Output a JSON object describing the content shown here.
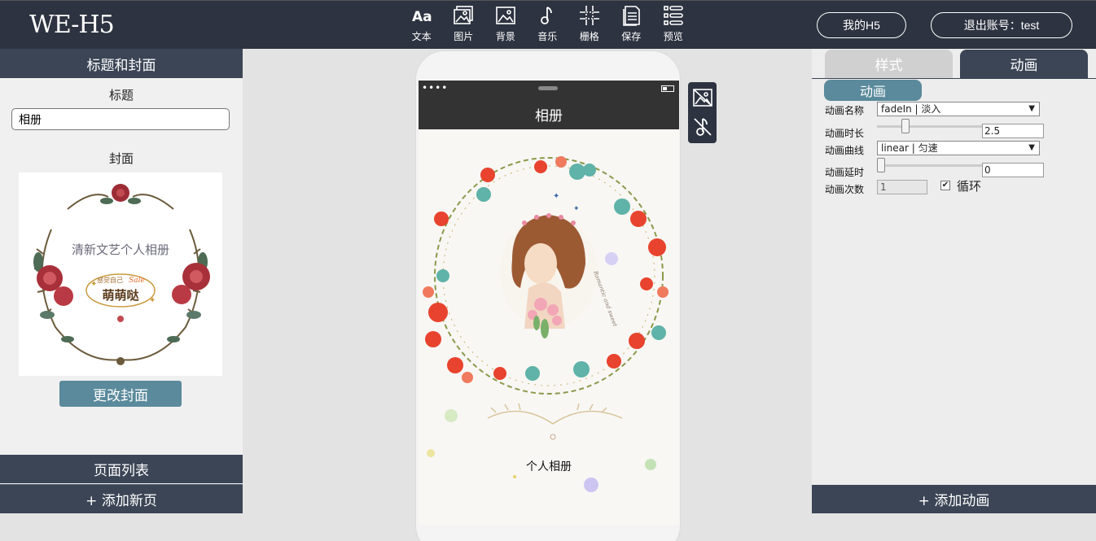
{
  "app": {
    "logo": "WE-H5"
  },
  "toolbar": {
    "items": [
      {
        "label": "文本",
        "icon": "text-icon"
      },
      {
        "label": "图片",
        "icon": "images-icon"
      },
      {
        "label": "背景",
        "icon": "image-icon"
      },
      {
        "label": "音乐",
        "icon": "music-note-icon"
      },
      {
        "label": "栅格",
        "icon": "grid-icon"
      },
      {
        "label": "保存",
        "icon": "document-icon"
      },
      {
        "label": "预览",
        "icon": "list-icon"
      }
    ],
    "text_glyph": "Aa"
  },
  "header": {
    "my_h5": "我的H5",
    "logout": "退出账号：test"
  },
  "left_panel": {
    "header": "标题和封面",
    "title_label": "标题",
    "title_value": "相册",
    "cover_label": "封面",
    "cover_text": "清新文艺个人相册",
    "cover_badge_small": "感觉自己",
    "cover_badge_sale": "Sale",
    "cover_badge_main": "萌萌哒",
    "change_cover": "更改封面",
    "page_list": "页面列表",
    "add_page": "+ 添加新页"
  },
  "phone": {
    "status_dots": "••••",
    "nav_title": "相册",
    "caption": "个人相册",
    "script_text": "Romantic and sweet"
  },
  "right_panel": {
    "tabs": {
      "style": "样式",
      "animation": "动画"
    },
    "subtab": "动画",
    "fields": {
      "name_label": "动画名称",
      "name_value": "fadeIn | 淡入",
      "duration_label": "动画时长",
      "duration_value": "2.5",
      "duration_fraction": 0.25,
      "curve_label": "动画曲线",
      "curve_value": "linear | 匀速",
      "delay_label": "动画延时",
      "delay_value": "0",
      "delay_fraction": 0.0,
      "count_label": "动画次数",
      "count_value": "1",
      "loop_label": "循环",
      "loop_checked": true
    },
    "add_animation": "+ 添加动画"
  },
  "colors": {
    "dark": "#2d3340",
    "panel_header": "#3b4555",
    "accent": "#5a8a9b"
  }
}
